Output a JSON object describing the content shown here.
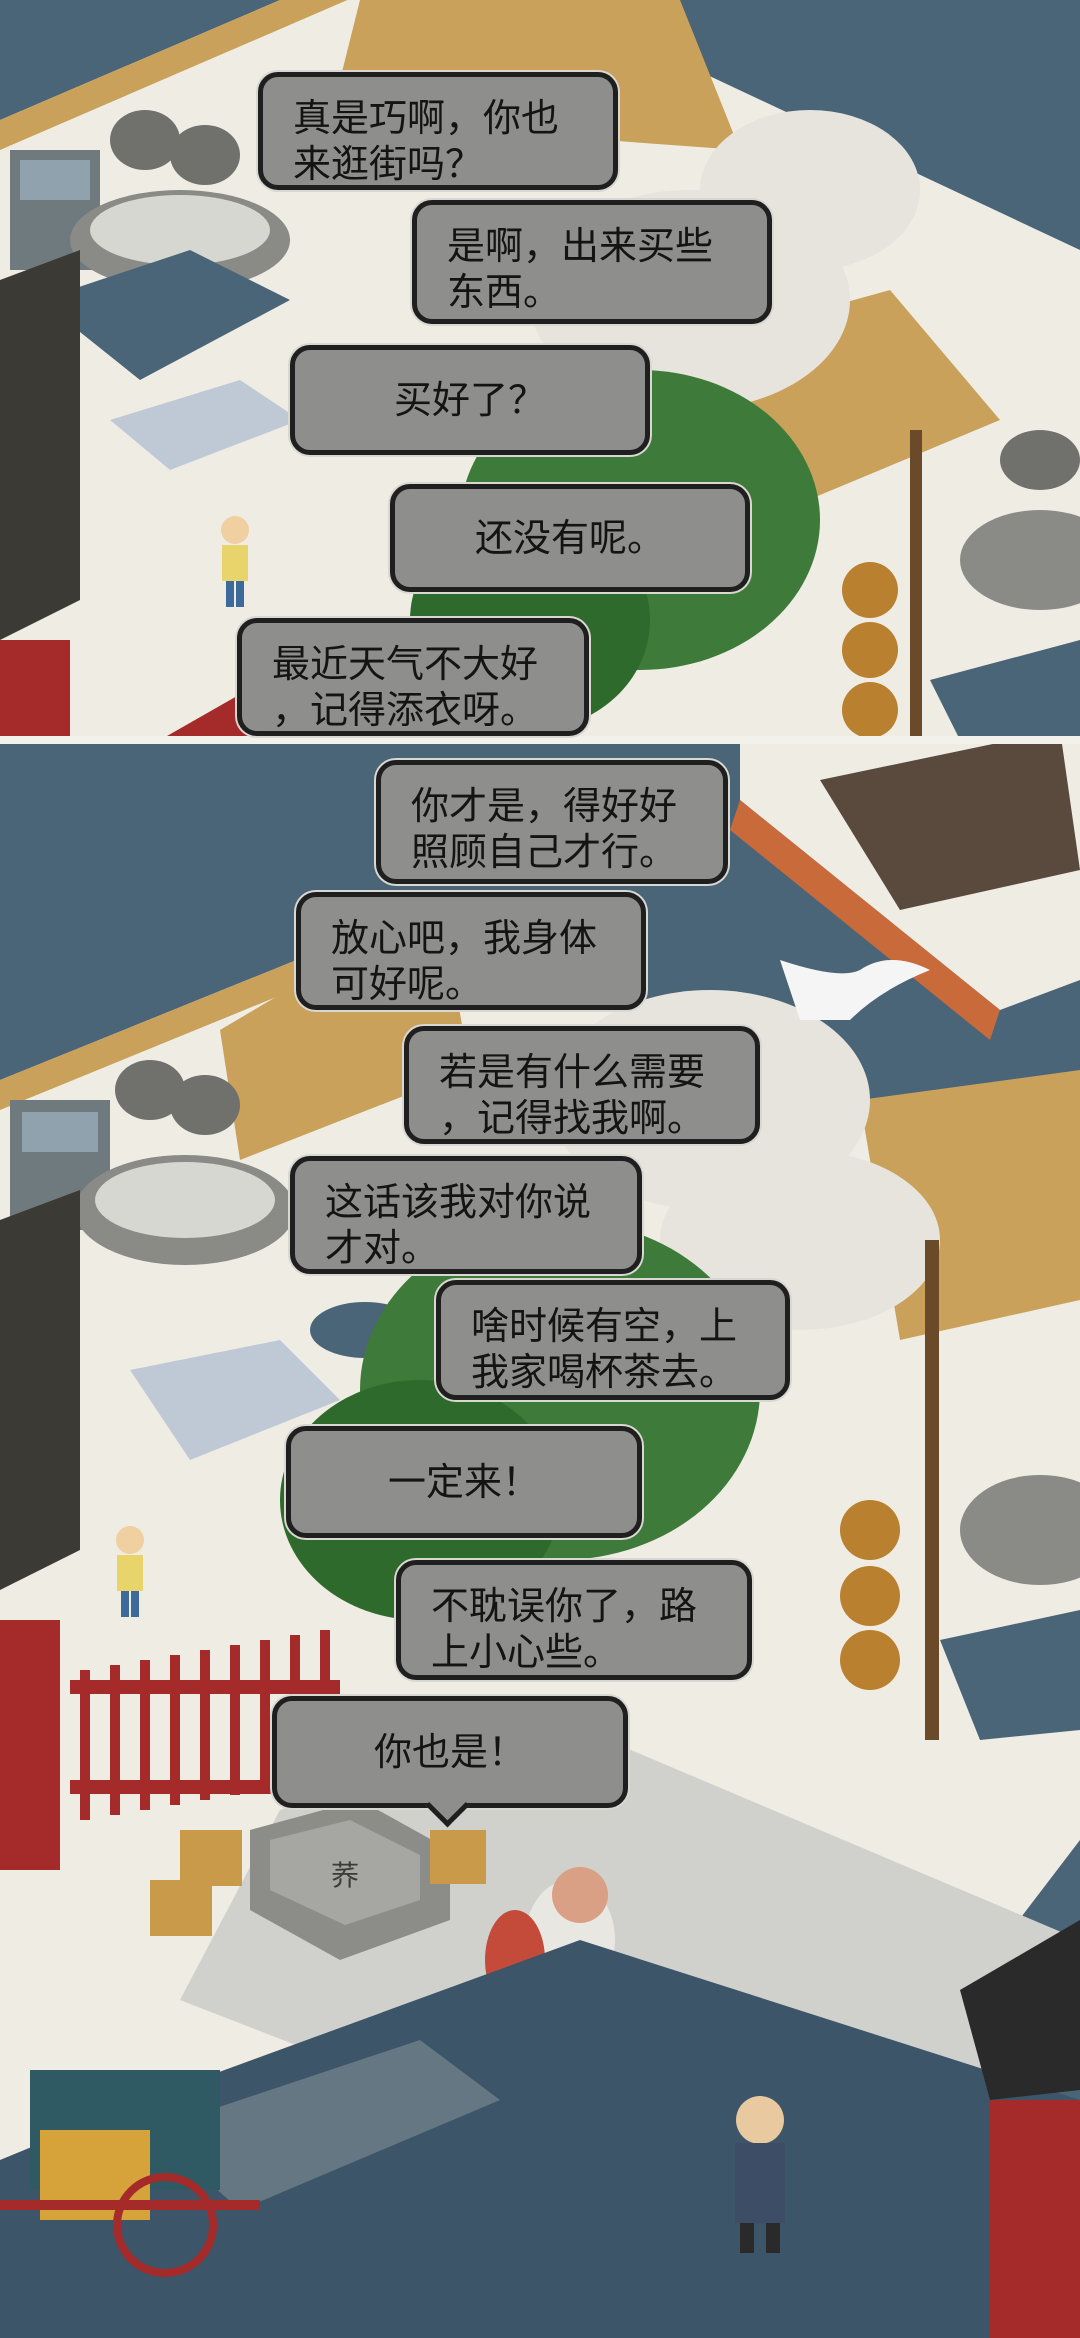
{
  "top_dialogue": [
    {
      "lines": [
        "真是巧啊，你也",
        "来逛街吗？"
      ]
    },
    {
      "lines": [
        "是啊，出来买些",
        "东西。"
      ]
    },
    {
      "lines": [
        "买好了？"
      ]
    },
    {
      "lines": [
        "还没有呢。"
      ]
    },
    {
      "lines": [
        "最近天气不大好",
        "，记得添衣呀。"
      ]
    }
  ],
  "bottom_dialogue": [
    {
      "lines": [
        "你才是，得好好",
        "照顾自己才行。"
      ]
    },
    {
      "lines": [
        "放心吧，我身体",
        "可好呢。"
      ]
    },
    {
      "lines": [
        "若是有什么需要",
        "，记得找我啊。"
      ]
    },
    {
      "lines": [
        "这话该我对你说",
        "才对。"
      ]
    },
    {
      "lines": [
        "啥时候有空，上",
        "我家喝杯茶去。"
      ]
    },
    {
      "lines": [
        "一定来！"
      ]
    },
    {
      "lines": [
        "不耽误你了，路",
        "上小心些。"
      ]
    },
    {
      "lines": [
        "你也是！"
      ]
    }
  ],
  "well_sign": "荞",
  "colors": {
    "water": "#4a6478",
    "ground": "#efece4",
    "bubble": "#8e8e8c",
    "roof": "#c9a15a",
    "fence": "#a52a2a"
  }
}
